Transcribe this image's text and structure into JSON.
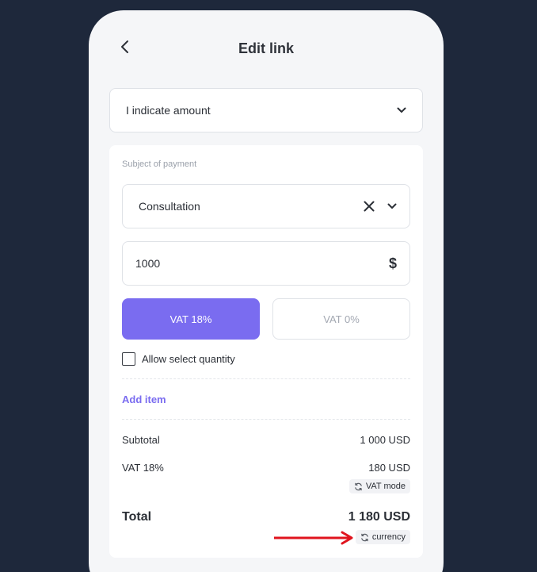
{
  "header": {
    "title": "Edit link",
    "back_icon": "chevron-left-icon"
  },
  "mode_select": {
    "value": "I indicate amount",
    "icon": "chevron-down-icon"
  },
  "form": {
    "subject_label": "Subject of payment",
    "subject_value": "Consultation",
    "amount_value": "1000",
    "currency_sign": "$",
    "vat_options": [
      {
        "label": "VAT 18%",
        "selected": true
      },
      {
        "label": "VAT 0%",
        "selected": false
      }
    ],
    "allow_quantity_label": "Allow select quantity",
    "allow_quantity_checked": false,
    "add_item_label": "Add item"
  },
  "summary": {
    "subtotal_label": "Subtotal",
    "subtotal_value": "1 000 USD",
    "vat_label": "VAT 18%",
    "vat_value": "180 USD",
    "vat_mode_label": "VAT mode",
    "total_label": "Total",
    "total_value": "1 180 USD",
    "currency_label": "currency"
  },
  "colors": {
    "background": "#1e283b",
    "accent": "#7a6cf0",
    "annotation_arrow": "#e0141e"
  }
}
